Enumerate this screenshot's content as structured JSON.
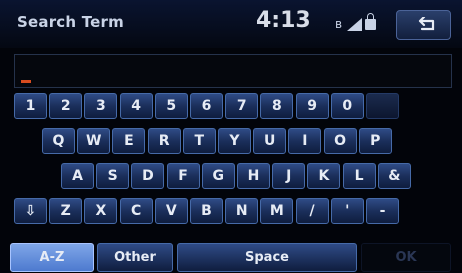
{
  "header": {
    "title": "Search Term",
    "clock": "4:13",
    "status_icons": [
      "bluetooth-icon",
      "signal-icon",
      "lock-icon"
    ],
    "back_icon": "back-arrow-icon"
  },
  "input": {
    "value": ""
  },
  "keyboard": {
    "row1": [
      "1",
      "2",
      "3",
      "4",
      "5",
      "6",
      "7",
      "8",
      "9",
      "0",
      ""
    ],
    "row2": [
      "Q",
      "W",
      "E",
      "R",
      "T",
      "Y",
      "U",
      "I",
      "O",
      "P"
    ],
    "row3": [
      "A",
      "S",
      "D",
      "F",
      "G",
      "H",
      "J",
      "K",
      "L",
      "&"
    ],
    "row4": [
      "⇩",
      "Z",
      "X",
      "C",
      "V",
      "B",
      "N",
      "M",
      "/",
      "'",
      "-"
    ]
  },
  "function_keys": {
    "az": "A-Z",
    "other": "Other",
    "space": "Space",
    "ok": "OK"
  },
  "colors": {
    "key_blue": "#1b2f5b",
    "selected_mode": "#6c93db",
    "cursor": "#d84c1f"
  }
}
